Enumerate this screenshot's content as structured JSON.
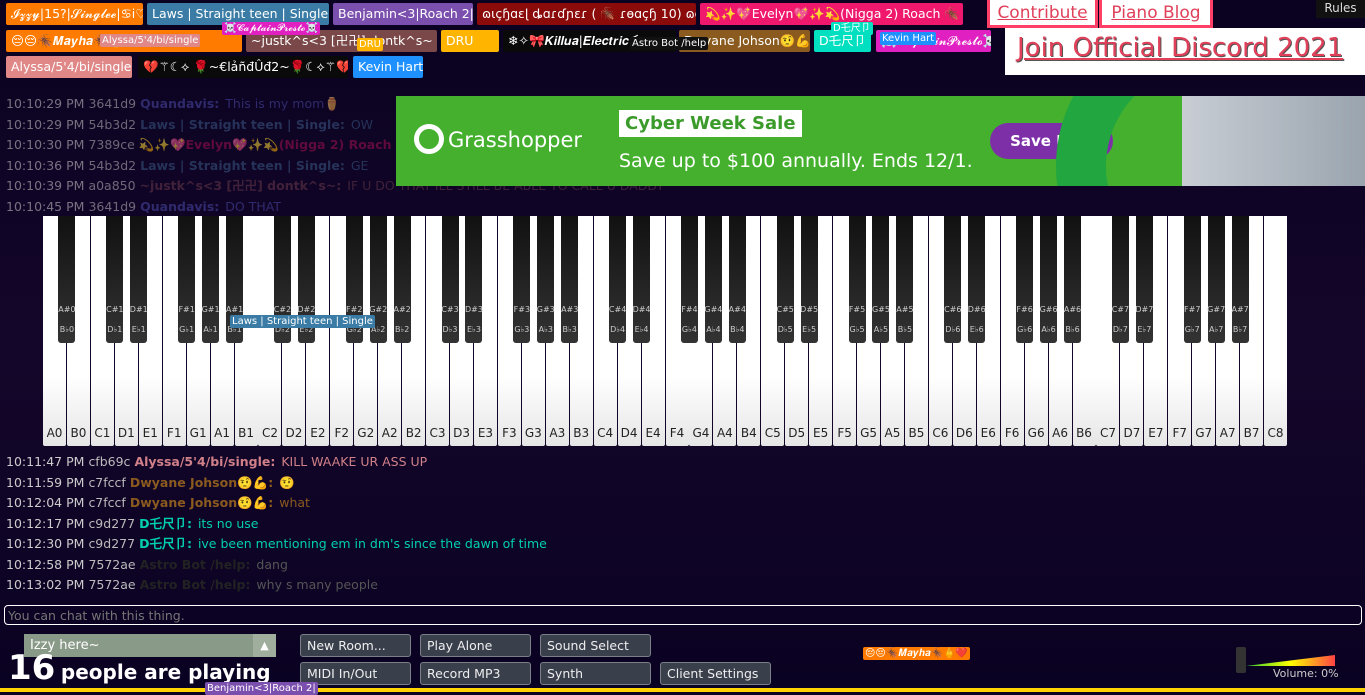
{
  "players": [
    {
      "name": "𝓘𝔃𝔃𝔂|15?|𝓢𝓲𝓷𝓰𝓵𝓮𝓮|♋i♡",
      "color": "#ff7b00"
    },
    {
      "name": "Laws | Straight teen | Single",
      "color": "#3a7ca5"
    },
    {
      "name": "Benjamin<3|Roach 2|",
      "color": "#7b4fae"
    },
    {
      "name": "ɷɩçɧɑɛɭ ȡɑɾɗɲɛɾ ( 🪳 ɾɵɑçɧ 10) ɷɵɲɩ",
      "color": "#8b0a0a"
    },
    {
      "name": "💫✨💖Evelyn💖✨💫(Nigga 2) Roach 🪳",
      "color": "#f0186c"
    },
    {
      "name": "😔😔🪳𝑴𝒂𝒚𝒉𝒂🪳🖕❤️",
      "color": "#ff7b00"
    },
    {
      "name": "~justk^s<3 [卍卍] dontk^s~",
      "color": "#7a4848"
    },
    {
      "name": "DRU",
      "color": "#ffb400"
    },
    {
      "name": "❄✧🎀𝑲𝒊𝒍𝒍𝒖𝒂|𝑬𝒍𝒆𝒄𝒕𝒓𝒊𝒄彡",
      "color": "#0a0a0a"
    },
    {
      "name": "Dwyane Johson🤨💪",
      "color": "#8a5a1e"
    },
    {
      "name": "D乇尺卩",
      "color": "#00e0c0"
    },
    {
      "name": "☠️𝓒𝓪𝓹𝓽𝓪𝓲𝓷𝓟𝓻𝓮𝓼𝓽𝓸☠️",
      "color": "#e020c0"
    },
    {
      "name": "Alyssa/5'4/bi/single",
      "color": "#e08888"
    },
    {
      "name": "💔⚚☾⟡ 🌹~€lảñđÛđ2~🌹☾⟡⚚💔",
      "color": "#0a0a0a"
    },
    {
      "name": "Kevin Hart",
      "color": "#1e90ff"
    }
  ],
  "floating_tags": [
    {
      "name": "Alyssa/5'4/bi/single",
      "color": "#e08888"
    },
    {
      "name": "☠️𝓒𝓪𝓹𝓽𝓪𝓲𝓷𝓟𝓻𝓮𝓼𝓽𝓸☠️",
      "color": "#e020c0"
    },
    {
      "name": "DRU",
      "color": "#ffb400"
    },
    {
      "name": "Astro Bot /help",
      "color": "#111111"
    },
    {
      "name": "D乇尺卩",
      "color": "#00e0c0"
    },
    {
      "name": "Kevin Hart",
      "color": "#1e90ff"
    },
    {
      "name": "Laws | Straight teen | Single",
      "color": "#3a7ca5"
    },
    {
      "name": "😔😔🪳𝑴𝒂𝒚𝒉𝒂🪳🖕❤️",
      "color": "#ff7b00"
    },
    {
      "name": "Benjamin<3|Roach 2|",
      "color": "#7b4fae"
    }
  ],
  "chat_top": [
    {
      "time": "10:10:29 PM",
      "id": "3641d9",
      "name": "Quandavis:",
      "text": "This is my mom⚱️",
      "color": "#4a4aa8"
    },
    {
      "time": "10:10:29 PM",
      "id": "54b3d2",
      "name": "Laws | Straight teen | Single:",
      "text": "OW",
      "color": "#3a5a85"
    },
    {
      "time": "10:10:30 PM",
      "id": "7389ce",
      "name": "💫✨💖Evelyn💖✨💫(Nigga 2) Roach",
      "text": "",
      "color": "#a01050"
    },
    {
      "time": "10:10:36 PM",
      "id": "54b3d2",
      "name": "Laws | Straight teen | Single:",
      "text": "GE",
      "color": "#3a5a85"
    },
    {
      "time": "10:10:39 PM",
      "id": "a0a850",
      "name": "~justk^s<3 [卍卍] dontk^s~:",
      "text": "IF U DO THAT ILL STILL BE ABLE TO CALL U DADDY",
      "color": "#6a3a4a"
    },
    {
      "time": "10:10:45 PM",
      "id": "3641d9",
      "name": "Quandavis:",
      "text": "DO THAT",
      "color": "#4a4aa8"
    }
  ],
  "chat_bottom": [
    {
      "time": "10:11:47 PM",
      "id": "cfb69c",
      "name": "Alyssa/5'4/bi/single:",
      "text": "KILL WAAKE UR ASS UP",
      "color": "#d08088"
    },
    {
      "time": "10:11:59 PM",
      "id": "c7fccf",
      "name": "Dwyane Johson🤨💪:",
      "text": "🤨",
      "color": "#8a5a1e"
    },
    {
      "time": "10:12:04 PM",
      "id": "c7fccf",
      "name": "Dwyane Johson🤨💪:",
      "text": "what",
      "color": "#8a5a1e"
    },
    {
      "time": "10:12:17 PM",
      "id": "c9d277",
      "name": "D乇尺卩:",
      "text": "its no use",
      "color": "#00d0b0"
    },
    {
      "time": "10:12:30 PM",
      "id": "c9d277",
      "name": "D乇尺卩:",
      "text": "ive been mentioning em in dm's since the dawn of time",
      "color": "#00d0b0"
    },
    {
      "time": "10:12:58 PM",
      "id": "7572ae",
      "name": "Astro Bot /help:",
      "text": "dang",
      "color": "#222222"
    },
    {
      "time": "10:13:02 PM",
      "id": "7572ae",
      "name": "Astro Bot /help:",
      "text": "why s many people",
      "color": "#222222"
    }
  ],
  "ad": {
    "brand": "Grasshopper",
    "headline": "Cyber Week Sale",
    "subline": "Save up to $100 annually. Ends 12/1.",
    "cta": "Save Now"
  },
  "links": {
    "contribute": "Contribute",
    "blog": "Piano Blog",
    "discord": "Join Official Discord 2021",
    "rules": "Rules"
  },
  "piano": {
    "white_keys": [
      "A0",
      "B0",
      "C1",
      "D1",
      "E1",
      "F1",
      "G1",
      "A1",
      "B1",
      "C2",
      "D2",
      "E2",
      "F2",
      "G2",
      "A2",
      "B2",
      "C3",
      "D3",
      "E3",
      "F3",
      "G3",
      "A3",
      "B3",
      "C4",
      "D4",
      "E4",
      "F4",
      "G4",
      "A4",
      "B4",
      "C5",
      "D5",
      "E5",
      "F5",
      "G5",
      "A5",
      "B5",
      "C6",
      "D6",
      "E6",
      "F6",
      "G6",
      "A6",
      "B6",
      "C7",
      "D7",
      "E7",
      "F7",
      "G7",
      "A7",
      "B7",
      "C8"
    ],
    "black_keys": [
      [
        "A#0",
        "B♭0"
      ],
      [
        "C#1",
        "D♭1"
      ],
      [
        "D#1",
        "E♭1"
      ],
      [
        "F#1",
        "G♭1"
      ],
      [
        "G#1",
        "A♭1"
      ],
      [
        "A#1",
        "B♭1"
      ],
      [
        "C#2",
        "D♭2"
      ],
      [
        "D#2",
        "E♭2"
      ],
      [
        "F#2",
        "G♭2"
      ],
      [
        "G#2",
        "A♭2"
      ],
      [
        "A#2",
        "B♭2"
      ],
      [
        "C#3",
        "D♭3"
      ],
      [
        "D#3",
        "E♭3"
      ],
      [
        "F#3",
        "G♭3"
      ],
      [
        "G#3",
        "A♭3"
      ],
      [
        "A#3",
        "B♭3"
      ],
      [
        "C#4",
        "D♭4"
      ],
      [
        "D#4",
        "E♭4"
      ],
      [
        "F#4",
        "G♭4"
      ],
      [
        "G#4",
        "A♭4"
      ],
      [
        "A#4",
        "B♭4"
      ],
      [
        "C#5",
        "D♭5"
      ],
      [
        "D#5",
        "E♭5"
      ],
      [
        "F#5",
        "G♭5"
      ],
      [
        "G#5",
        "A♭5"
      ],
      [
        "A#5",
        "B♭5"
      ],
      [
        "C#6",
        "D♭6"
      ],
      [
        "D#6",
        "E♭6"
      ],
      [
        "F#6",
        "G♭6"
      ],
      [
        "G#6",
        "A♭6"
      ],
      [
        "A#6",
        "B♭6"
      ],
      [
        "C#7",
        "D♭7"
      ],
      [
        "D#7",
        "E♭7"
      ],
      [
        "F#7",
        "G♭7"
      ],
      [
        "G#7",
        "A♭7"
      ],
      [
        "A#7",
        "B♭7"
      ]
    ]
  },
  "chat_input": {
    "placeholder": "You can chat with this thing."
  },
  "room": {
    "name": "Izzy here~",
    "count": "16",
    "count_label": "people are playing"
  },
  "buttons": {
    "new_room": "New Room...",
    "play_alone": "Play Alone",
    "sound_select": "Sound Select",
    "midi": "MIDI In/Out",
    "record": "Record MP3",
    "synth": "Synth",
    "client_settings": "Client Settings"
  },
  "volume": {
    "label": "Volume: 0%",
    "value": 0
  }
}
